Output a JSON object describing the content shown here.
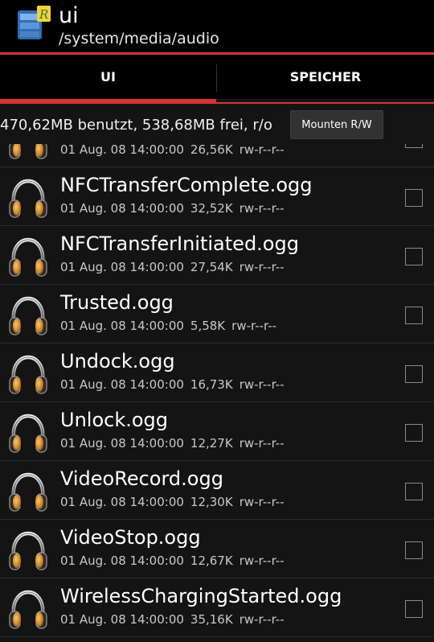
{
  "header": {
    "title": "ui",
    "path": "/system/media/audio",
    "app_icon": "root-explorer-app-icon"
  },
  "tabs": [
    {
      "label": "UI",
      "active": true
    },
    {
      "label": "SPEICHER",
      "active": false
    }
  ],
  "storage": {
    "status": "470,62MB benutzt, 538,68MB frei, r/o",
    "mount_button_label": "Mounten R/W"
  },
  "colors": {
    "accent": "#d43434",
    "background": "#141414",
    "topbar": "#000000"
  },
  "files": [
    {
      "name": "",
      "date": "01 Aug. 08 14:00:00",
      "size": "26,56K",
      "perms": "rw-r--r--"
    },
    {
      "name": "NFCTransferComplete.ogg",
      "date": "01 Aug. 08 14:00:00",
      "size": "32,52K",
      "perms": "rw-r--r--"
    },
    {
      "name": "NFCTransferInitiated.ogg",
      "date": "01 Aug. 08 14:00:00",
      "size": "27,54K",
      "perms": "rw-r--r--"
    },
    {
      "name": "Trusted.ogg",
      "date": "01 Aug. 08 14:00:00",
      "size": "5,58K",
      "perms": "rw-r--r--"
    },
    {
      "name": "Undock.ogg",
      "date": "01 Aug. 08 14:00:00",
      "size": "16,73K",
      "perms": "rw-r--r--"
    },
    {
      "name": "Unlock.ogg",
      "date": "01 Aug. 08 14:00:00",
      "size": "12,27K",
      "perms": "rw-r--r--"
    },
    {
      "name": "VideoRecord.ogg",
      "date": "01 Aug. 08 14:00:00",
      "size": "12,30K",
      "perms": "rw-r--r--"
    },
    {
      "name": "VideoStop.ogg",
      "date": "01 Aug. 08 14:00:00",
      "size": "12,67K",
      "perms": "rw-r--r--"
    },
    {
      "name": "WirelessChargingStarted.ogg",
      "date": "01 Aug. 08 14:00:00",
      "size": "35,16K",
      "perms": "rw-r--r--"
    }
  ],
  "file_icon": "headphones-icon"
}
